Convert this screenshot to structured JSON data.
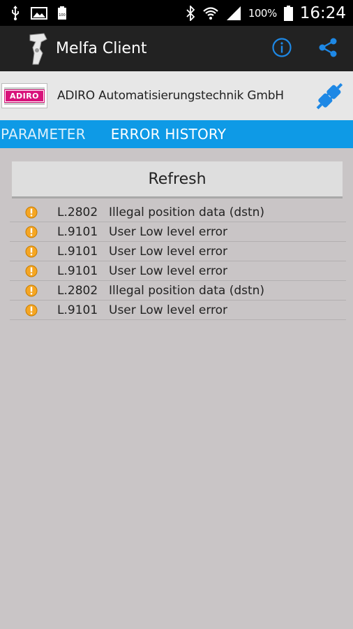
{
  "status_bar": {
    "battery_percent": "100%",
    "time": "16:24",
    "icons_left": [
      "usb-icon",
      "image-icon",
      "battery-saver-icon"
    ],
    "icons_right": [
      "bluetooth-icon",
      "wifi-icon",
      "signal-icon",
      "battery-icon"
    ]
  },
  "action_bar": {
    "title": "Melfa Client",
    "icons": [
      "robot-arm-logo-icon",
      "info-icon",
      "share-icon"
    ]
  },
  "company": {
    "logo_text": "ADIRO",
    "name": "ADIRO Automatisierungstechnik GmbH",
    "connection_icon": "plug-icon"
  },
  "tabs": [
    {
      "label": "PARAMETER",
      "selected": false
    },
    {
      "label": "ERROR HISTORY",
      "selected": true
    }
  ],
  "refresh_label": "Refresh",
  "errors": [
    {
      "code": "L.2802",
      "message": "Illegal position data (dstn)"
    },
    {
      "code": "L.9101",
      "message": "User Low level error"
    },
    {
      "code": "L.9101",
      "message": "User Low level error"
    },
    {
      "code": "L.9101",
      "message": "User Low level error"
    },
    {
      "code": "L.2802",
      "message": "Illegal position data (dstn)"
    },
    {
      "code": "L.9101",
      "message": "User Low level error"
    }
  ],
  "colors": {
    "tab_bar": "#0e9ae6",
    "action_bar": "#222222",
    "icon_accent": "#1e88e5",
    "warning": "#f5a623"
  }
}
